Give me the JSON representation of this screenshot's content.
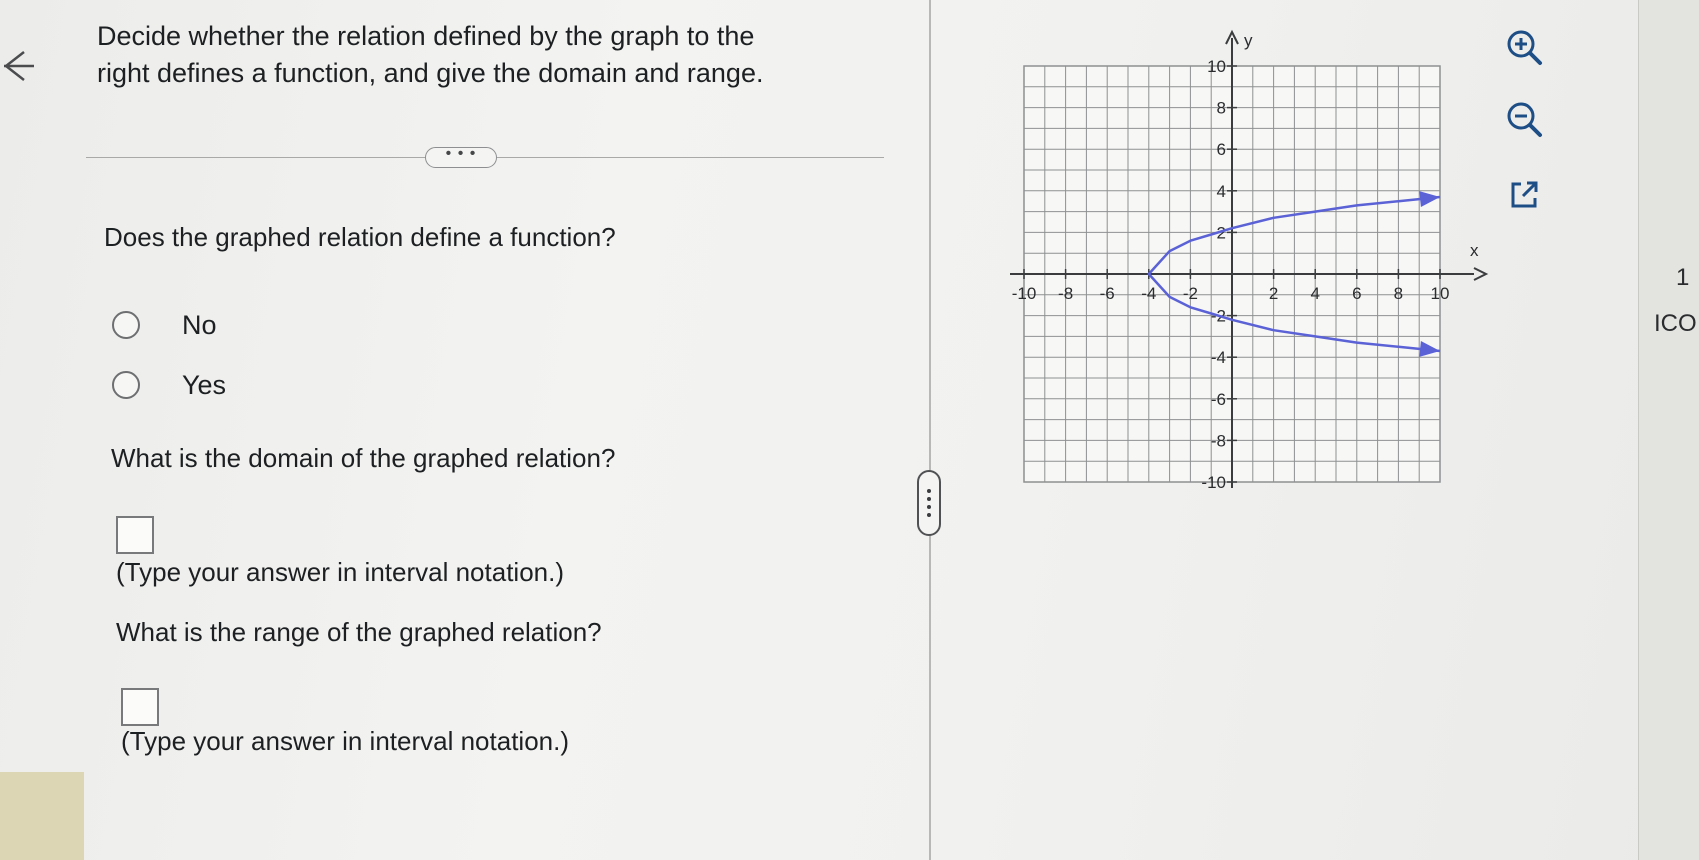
{
  "question": {
    "line1": "Decide whether the relation defined by the graph to the",
    "line2": "right defines a function, and give the domain and range."
  },
  "expand_label": "• • •",
  "q1": {
    "prompt": "Does the graphed relation define a function?",
    "options": [
      "No",
      "Yes"
    ]
  },
  "q2": {
    "prompt": "What is the domain of the graphed relation?",
    "hint": "(Type your answer in interval notation.)"
  },
  "q3": {
    "prompt": "What is the range of the graphed relation?",
    "hint": "(Type your answer in interval notation.)"
  },
  "edge": {
    "number": "1",
    "word": "ICO"
  },
  "icons": {
    "back": "back-arrow-icon",
    "zoom_in": "zoom-in-icon",
    "zoom_out": "zoom-out-icon",
    "popout": "external-link-icon"
  },
  "colors": {
    "curve": "#5b62d6",
    "grid": "#8e9091",
    "axis": "#3a3c3e"
  },
  "chart_data": {
    "type": "line",
    "title": "",
    "xlabel": "x",
    "ylabel": "y",
    "xlim": [
      -10,
      10
    ],
    "ylim": [
      -10,
      10
    ],
    "grid": true,
    "x_ticks": [
      -10,
      -8,
      -6,
      -4,
      -2,
      2,
      4,
      6,
      8,
      10
    ],
    "y_ticks": [
      10,
      8,
      6,
      4,
      2,
      -2,
      -4,
      -6,
      -8,
      -10
    ],
    "x_tick_labels": [
      "-10",
      "-8",
      "-6",
      "-4",
      "-2",
      "2",
      "4",
      "6",
      "8",
      "10"
    ],
    "y_tick_labels": [
      "10",
      "8",
      "6",
      "4",
      "2",
      "-2",
      "-4",
      "-6",
      "-8",
      "-10"
    ],
    "series": [
      {
        "x": [
          10,
          8,
          6,
          4,
          2,
          0,
          -1,
          -2,
          -3,
          -4,
          -3,
          -2,
          -1,
          0,
          2,
          4,
          6,
          8,
          10
        ],
        "y": [
          3.7,
          3.5,
          3.3,
          3.0,
          2.7,
          2.2,
          1.9,
          1.6,
          1.1,
          0,
          -1.1,
          -1.6,
          -1.9,
          -2.2,
          -2.7,
          -3.0,
          -3.3,
          -3.5,
          -3.7
        ],
        "arrows_at_ends": true
      }
    ]
  }
}
